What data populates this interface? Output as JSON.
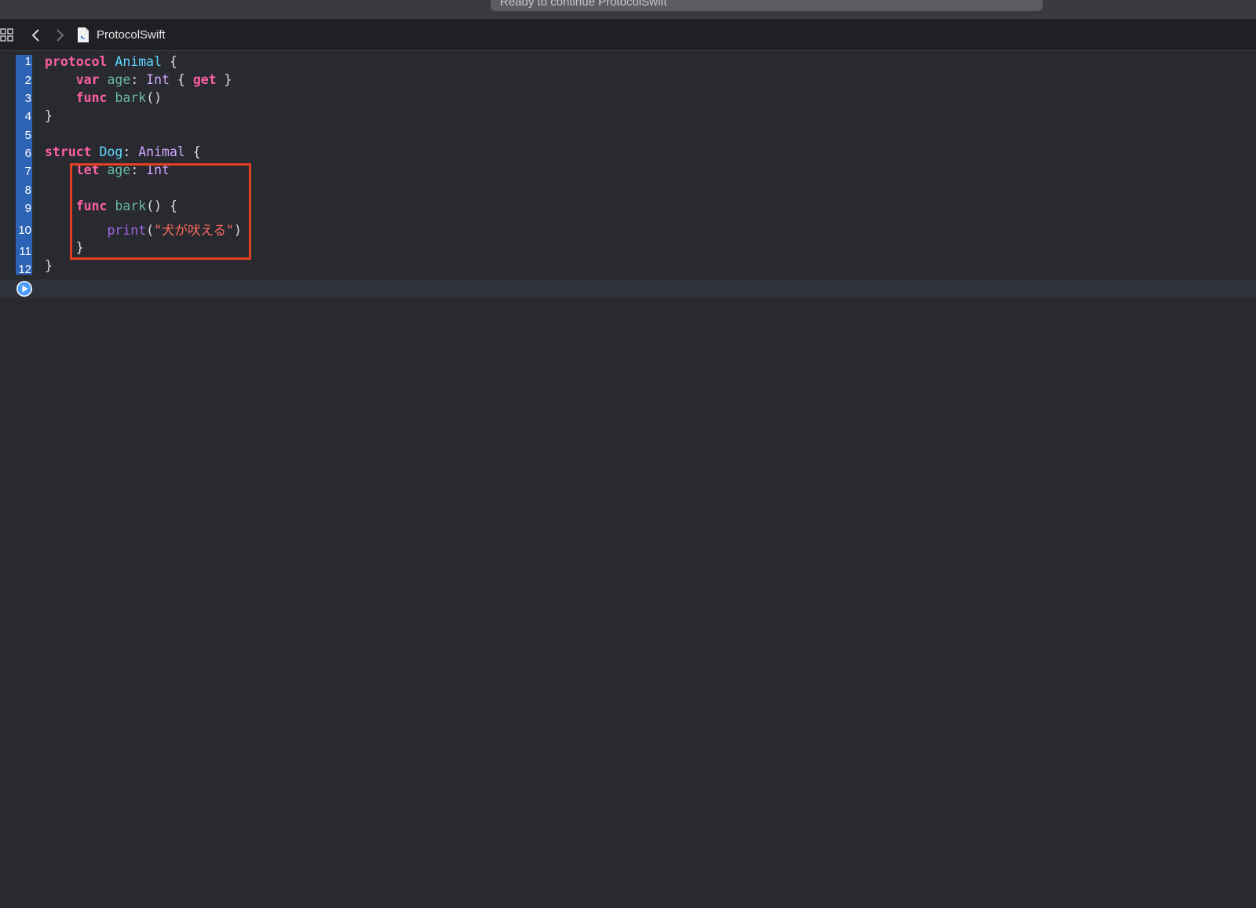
{
  "activity_status": "Ready to continue ProtocolSwift",
  "jumpbar": {
    "file_name": "ProtocolSwift",
    "icons": [
      "grid-icon",
      "back-icon",
      "forward-icon",
      "swift-file-icon"
    ]
  },
  "editor": {
    "line_numbers": [
      "1",
      "2",
      "3",
      "4",
      "5",
      "6",
      "7",
      "8",
      "9",
      "10",
      "11",
      "12"
    ],
    "lines": [
      [
        {
          "t": "protocol",
          "c": "kw"
        },
        {
          "t": " ",
          "c": "plain"
        },
        {
          "t": "Animal",
          "c": "tydecl"
        },
        {
          "t": " {",
          "c": "plain"
        }
      ],
      [
        {
          "t": "    ",
          "c": "plain"
        },
        {
          "t": "var",
          "c": "kw"
        },
        {
          "t": " ",
          "c": "plain"
        },
        {
          "t": "age",
          "c": "prop"
        },
        {
          "t": ": ",
          "c": "plain"
        },
        {
          "t": "Int",
          "c": "ty"
        },
        {
          "t": " { ",
          "c": "plain"
        },
        {
          "t": "get",
          "c": "kw"
        },
        {
          "t": " }",
          "c": "plain"
        }
      ],
      [
        {
          "t": "    ",
          "c": "plain"
        },
        {
          "t": "func",
          "c": "kw"
        },
        {
          "t": " ",
          "c": "plain"
        },
        {
          "t": "bark",
          "c": "fn"
        },
        {
          "t": "()",
          "c": "plain"
        }
      ],
      [
        {
          "t": "}",
          "c": "plain"
        }
      ],
      [],
      [
        {
          "t": "struct",
          "c": "kw"
        },
        {
          "t": " ",
          "c": "plain"
        },
        {
          "t": "Dog",
          "c": "tydecl"
        },
        {
          "t": ": ",
          "c": "plain"
        },
        {
          "t": "Animal",
          "c": "ty"
        },
        {
          "t": " {",
          "c": "plain"
        }
      ],
      [
        {
          "t": "    ",
          "c": "plain"
        },
        {
          "t": "let",
          "c": "kw"
        },
        {
          "t": " ",
          "c": "plain"
        },
        {
          "t": "age",
          "c": "prop"
        },
        {
          "t": ": ",
          "c": "plain"
        },
        {
          "t": "Int",
          "c": "ty"
        }
      ],
      [],
      [
        {
          "t": "    ",
          "c": "plain"
        },
        {
          "t": "func",
          "c": "kw"
        },
        {
          "t": " ",
          "c": "plain"
        },
        {
          "t": "bark",
          "c": "fn"
        },
        {
          "t": "() {",
          "c": "plain"
        }
      ],
      [
        {
          "t": "        ",
          "c": "plain"
        },
        {
          "t": "print",
          "c": "call"
        },
        {
          "t": "(",
          "c": "plain"
        },
        {
          "t": "\"犬が吠える\"",
          "c": "str"
        },
        {
          "t": ")",
          "c": "plain"
        }
      ],
      [
        {
          "t": "    }",
          "c": "plain"
        }
      ],
      [
        {
          "t": "}",
          "c": "plain"
        }
      ]
    ]
  },
  "colors": {
    "background": "#292a30",
    "gutter_highlight": "#2d63b5",
    "keyword": "#fc5fa3",
    "type": "#d0a8ff",
    "string": "#fc6a5d",
    "annotation_box": "#e2401f",
    "run_button": "#4a9df8"
  }
}
